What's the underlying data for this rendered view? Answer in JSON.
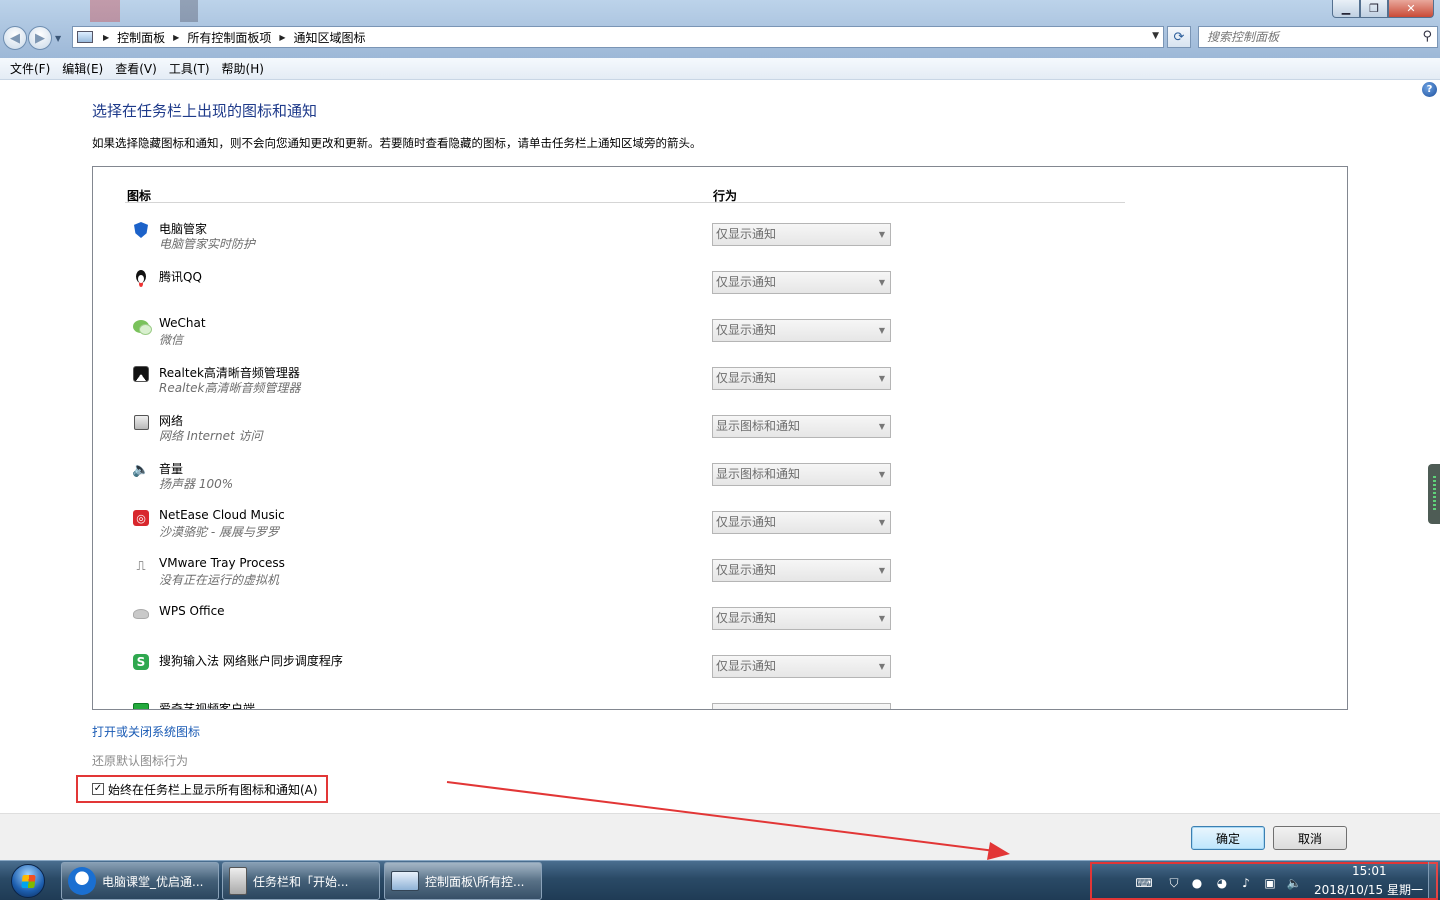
{
  "address": {
    "segments": [
      "控制面板",
      "所有控制面板项",
      "通知区域图标"
    ],
    "search_placeholder": "搜索控制面板"
  },
  "menu": [
    "文件(F)",
    "编辑(E)",
    "查看(V)",
    "工具(T)",
    "帮助(H)"
  ],
  "page": {
    "title": "选择在任务栏上出现的图标和通知",
    "description": "如果选择隐藏图标和通知，则不会向您通知更改和更新。若要随时查看隐藏的图标，请单击任务栏上通知区域旁的箭头。"
  },
  "columns": {
    "icon": "图标",
    "behavior": "行为"
  },
  "rows": [
    {
      "name": "电脑管家",
      "sub": "电脑管家实时防护",
      "behavior": "仅显示通知",
      "icon": "shield-icon"
    },
    {
      "name": "腾讯QQ",
      "sub": "",
      "behavior": "仅显示通知",
      "icon": "qq-penguin-icon"
    },
    {
      "name": "WeChat",
      "sub": "微信",
      "behavior": "仅显示通知",
      "icon": "wechat-icon"
    },
    {
      "name": "Realtek高清晰音频管理器",
      "sub": "Realtek高清晰音频管理器",
      "behavior": "仅显示通知",
      "icon": "realtek-icon"
    },
    {
      "name": "网络",
      "sub": "网络 Internet 访问",
      "behavior": "显示图标和通知",
      "icon": "network-icon"
    },
    {
      "name": "音量",
      "sub": "扬声器 100%",
      "behavior": "显示图标和通知",
      "icon": "volume-icon"
    },
    {
      "name": "NetEase Cloud Music",
      "sub": "沙漠骆驼 - 展展与罗罗",
      "behavior": "仅显示通知",
      "icon": "netease-music-icon"
    },
    {
      "name": "VMware Tray Process",
      "sub": "没有正在运行的虚拟机",
      "behavior": "仅显示通知",
      "icon": "vmware-icon"
    },
    {
      "name": "WPS Office",
      "sub": "",
      "behavior": "仅显示通知",
      "icon": "wps-icon"
    },
    {
      "name": "搜狗输入法 网络账户同步调度程序",
      "sub": "",
      "behavior": "仅显示通知",
      "icon": "sogou-icon"
    },
    {
      "name": "爱奇艺视频客户端",
      "sub": "",
      "behavior": "",
      "icon": "iqiyi-icon"
    }
  ],
  "links": {
    "system_icons": "打开或关闭系统图标",
    "restore_default": "还原默认图标行为"
  },
  "checkbox": {
    "label": "始终在任务栏上显示所有图标和通知(A)",
    "checked": true
  },
  "buttons": {
    "ok": "确定",
    "cancel": "取消"
  },
  "taskbar": {
    "tasks": [
      "电脑课堂_优启通...",
      "任务栏和「开始...",
      "控制面板\\所有控..."
    ],
    "time": "15:01",
    "date": "2018/10/15 星期一"
  },
  "colors": {
    "title_blue": "#1e3a8a",
    "link_blue": "#1a5bb5",
    "highlight_red": "#e23636"
  }
}
